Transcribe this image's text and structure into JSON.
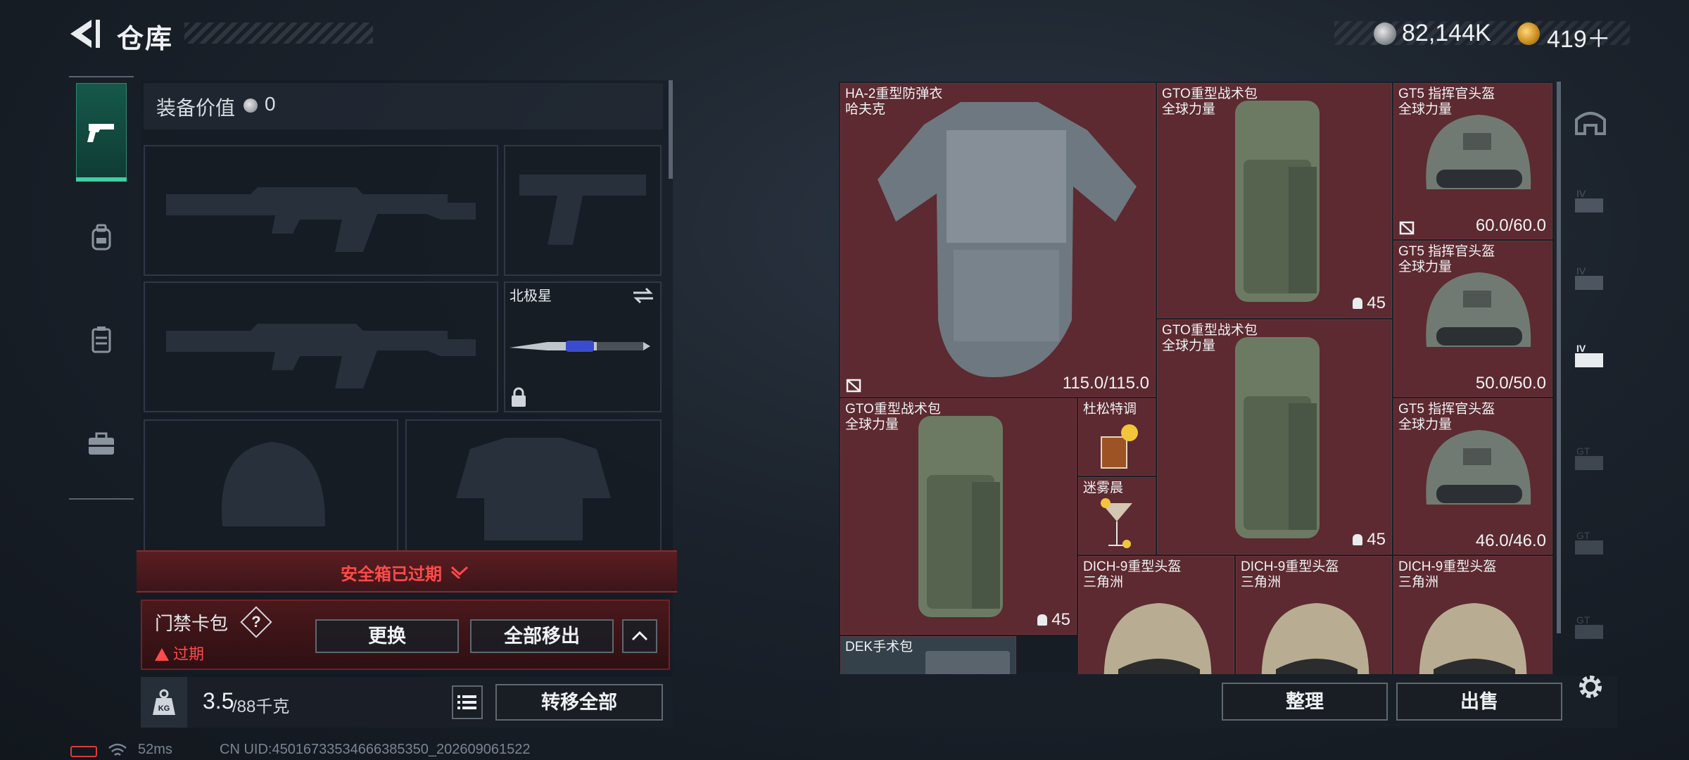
{
  "header": {
    "title": "仓库",
    "currency1": "82,144K",
    "currency2": "419＋"
  },
  "equip_value": {
    "label": "装备价值",
    "value": "0"
  },
  "slots": {
    "melee_name": "北极星"
  },
  "safe_box": {
    "status": "安全箱已过期"
  },
  "card_pack": {
    "title": "门禁卡包",
    "help": "?",
    "expired": "过期",
    "replace": "更换",
    "move_all": "全部移出"
  },
  "weight": {
    "current": "3.5",
    "max": "/88千克"
  },
  "transfer_all": "转移全部",
  "status_bar": {
    "ping": "52ms",
    "uid": "CN UID:45016733534666385350_202609061522"
  },
  "grid_items": [
    {
      "name": "HA-2重型防弹衣",
      "sub": "哈夫克",
      "durability": "115.0/115.0",
      "kind": "armor"
    },
    {
      "name": "GTO重型战术包",
      "sub": "全球力量",
      "capacity": "45",
      "kind": "backpack"
    },
    {
      "name": "GT5 指挥官头盔",
      "sub": "全球力量",
      "durability": "60.0/60.0",
      "kind": "helmet"
    },
    {
      "name": "GT5 指挥官头盔",
      "sub": "全球力量",
      "durability": "50.0/50.0",
      "kind": "helmet"
    },
    {
      "name": "GTO重型战术包",
      "sub": "全球力量",
      "capacity": "45",
      "kind": "backpack"
    },
    {
      "name": "GTO重型战术包",
      "sub": "全球力量",
      "capacity": "45",
      "kind": "backpack"
    },
    {
      "name": "杜松特调",
      "sub": "",
      "kind": "drink"
    },
    {
      "name": "迷雾晨",
      "sub": "",
      "kind": "cocktail"
    },
    {
      "name": "GT5 指挥官头盔",
      "sub": "全球力量",
      "durability": "46.0/46.0",
      "kind": "helmet"
    },
    {
      "name": "DICH-9重型头盔",
      "sub": "三角洲",
      "kind": "helmet2"
    },
    {
      "name": "DICH-9重型头盔",
      "sub": "三角洲",
      "kind": "helmet2"
    },
    {
      "name": "DICH-9重型头盔",
      "sub": "三角洲",
      "kind": "helmet2"
    },
    {
      "name": "DEK手术包",
      "sub": "",
      "kind": "medkit"
    }
  ],
  "actions": {
    "sort": "整理",
    "sell": "出售"
  }
}
